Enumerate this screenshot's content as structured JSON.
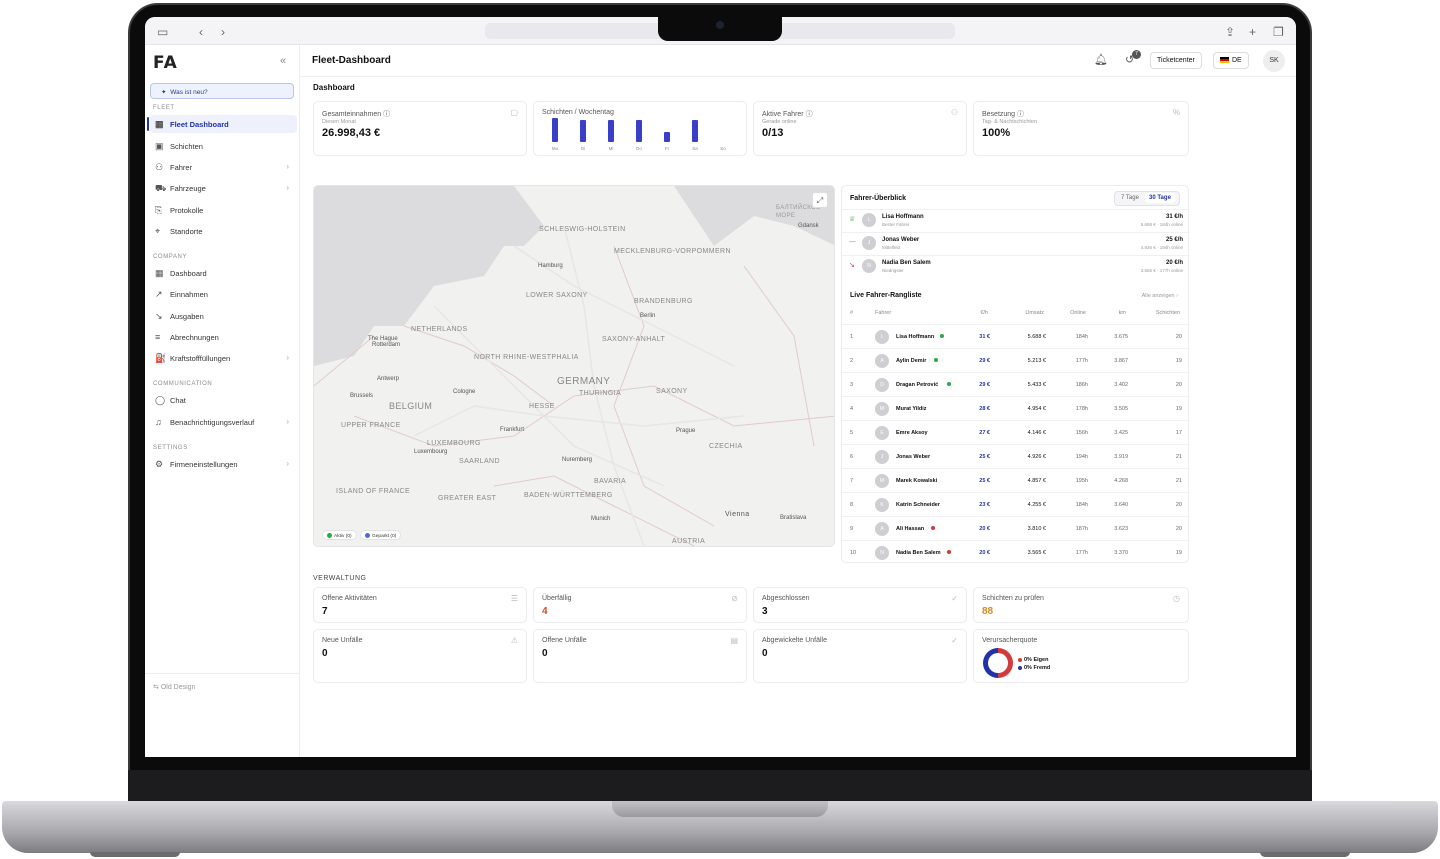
{
  "app": {
    "logo": "FA",
    "title": "Fleet-Dashboard",
    "breadcrumb": "Dashboard"
  },
  "sidebar": {
    "whats_new": "Was ist neu?",
    "sections": [
      {
        "label": "FLEET"
      },
      {
        "label": "COMPANY"
      },
      {
        "label": "COMMUNICATION"
      },
      {
        "label": "SETTINGS"
      }
    ],
    "items": [
      {
        "label": "Fleet Dashboard",
        "icon": "grid-icon"
      },
      {
        "label": "Schichten",
        "icon": "calendar-icon"
      },
      {
        "label": "Fahrer",
        "icon": "users-icon"
      },
      {
        "label": "Fahrzeuge",
        "icon": "car-icon"
      },
      {
        "label": "Protokolle",
        "icon": "log-icon"
      },
      {
        "label": "Standorte",
        "icon": "pin-icon"
      },
      {
        "label": "Dashboard",
        "icon": "grid-icon"
      },
      {
        "label": "Einnahmen",
        "icon": "trend-up-icon"
      },
      {
        "label": "Ausgaben",
        "icon": "trend-down-icon"
      },
      {
        "label": "Abrechnungen",
        "icon": "bars-icon"
      },
      {
        "label": "Kraftstofffüllungen",
        "icon": "fuel-icon"
      },
      {
        "label": "Chat",
        "icon": "chat-icon"
      },
      {
        "label": "Benachrichtigungsverlauf",
        "icon": "bell-icon"
      },
      {
        "label": "Firmeneinstellungen",
        "icon": "gear-icon"
      }
    ],
    "old_design": "Old Design"
  },
  "topbar": {
    "badge": "7",
    "ticketcenter": "Ticketcenter",
    "lang": "DE",
    "user": "SK"
  },
  "kpis": [
    {
      "label": "Gesamteinnahmen",
      "sub": "Diesen Monat",
      "value": "26.998,43 €"
    },
    {
      "label": "Schichten / Wochentag"
    },
    {
      "label": "Aktive Fahrer",
      "sub": "Gerade online",
      "value": "0/13"
    },
    {
      "label": "Besetzung",
      "sub": "Tag- & Nachtschichten",
      "value": "100%"
    }
  ],
  "chart_data": {
    "type": "bar",
    "title": "Schichten / Wochentag",
    "categories": [
      "Mo",
      "Di",
      "Mi",
      "Do",
      "Fr",
      "Sa",
      "So"
    ],
    "values": [
      5,
      4.5,
      4.5,
      4.5,
      2,
      4.5,
      0
    ],
    "ylim": [
      0,
      5
    ],
    "grid": false
  },
  "map": {
    "regions": [
      "Schleswig-Holstein",
      "Mecklenburg-Vorpommern",
      "Lower Saxony",
      "Brandenburg",
      "Netherlands",
      "North Rhine-Westphalia",
      "Saxony-Anhalt",
      "Germany",
      "Belgium",
      "Hesse",
      "Thuringia",
      "Saxony",
      "Upper France",
      "Luxembourg",
      "Saarland",
      "Czechia",
      "Bavaria",
      "Baden-Württemberg",
      "Island of France",
      "Greater East",
      "Austria"
    ],
    "cities": [
      "Hamburg",
      "Berlin",
      "The Hague",
      "Rotterdam",
      "Antwerp",
      "Cologne",
      "Brussels",
      "Frankfurt",
      "Prague",
      "Luxembourg",
      "Nuremberg",
      "Munich",
      "Vienna",
      "Bratislava",
      "Gdansk"
    ],
    "sea": "Балтийское море",
    "legend": [
      {
        "label": "Aktiv (0)",
        "color": "#2ca84a"
      },
      {
        "label": "Geparkt (0)",
        "color": "#5b63d8"
      }
    ]
  },
  "overview": {
    "title": "Fahrer-Überblick",
    "tabs": [
      "7 Tage",
      "30 Tage"
    ],
    "rows": [
      {
        "initial": "L",
        "name": "Lisa Hoffmann",
        "desc": "Bester Fahrer",
        "rate": "31 €/h",
        "sub": "5.688 € · 184h online"
      },
      {
        "initial": "J",
        "name": "Jonas Weber",
        "desc": "Mittelfeld",
        "rate": "25 €/h",
        "sub": "4.926 € · 194h online"
      },
      {
        "initial": "N",
        "name": "Nadia Ben Salem",
        "desc": "Niedrigster",
        "rate": "20 €/h",
        "sub": "3.565 € · 177h online"
      }
    ]
  },
  "leaderboard": {
    "title": "Live Fahrer-Rangliste",
    "all": "Alle anzeigen",
    "columns": [
      "#",
      "Fahrer",
      "€/h",
      "Umsatz",
      "Online",
      "km",
      "Schichten"
    ],
    "rows": [
      {
        "n": "1",
        "i": "L",
        "name": "Lisa Hoffmann",
        "dot": "#2ca84a",
        "rate": "31 €",
        "rev": "5.688 €",
        "on": "184h",
        "km": "3.675",
        "s": "20"
      },
      {
        "n": "2",
        "i": "A",
        "name": "Aylin Demir",
        "dot": "#2ca84a",
        "rate": "29 €",
        "rev": "5.213 €",
        "on": "177h",
        "km": "3.867",
        "s": "19"
      },
      {
        "n": "3",
        "i": "D",
        "name": "Dragan Petrović",
        "dot": "#2ca84a",
        "rate": "29 €",
        "rev": "5.433 €",
        "on": "186h",
        "km": "3.402",
        "s": "20"
      },
      {
        "n": "4",
        "i": "M",
        "name": "Murat Yildiz",
        "dot": "",
        "rate": "28 €",
        "rev": "4.954 €",
        "on": "178h",
        "km": "3.505",
        "s": "19"
      },
      {
        "n": "5",
        "i": "E",
        "name": "Emre Aksoy",
        "dot": "",
        "rate": "27 €",
        "rev": "4.146 €",
        "on": "156h",
        "km": "3.425",
        "s": "17"
      },
      {
        "n": "6",
        "i": "J",
        "name": "Jonas Weber",
        "dot": "",
        "rate": "25 €",
        "rev": "4.926 €",
        "on": "194h",
        "km": "3.919",
        "s": "21"
      },
      {
        "n": "7",
        "i": "M",
        "name": "Marek Kowalski",
        "dot": "",
        "rate": "25 €",
        "rev": "4.857 €",
        "on": "195h",
        "km": "4.268",
        "s": "21"
      },
      {
        "n": "8",
        "i": "K",
        "name": "Katrin Schneider",
        "dot": "",
        "rate": "23 €",
        "rev": "4.255 €",
        "on": "184h",
        "km": "3.640",
        "s": "20"
      },
      {
        "n": "9",
        "i": "A",
        "name": "Ali Hassan",
        "dot": "#d23b3b",
        "rate": "20 €",
        "rev": "3.810 €",
        "on": "187h",
        "km": "3.623",
        "s": "20"
      },
      {
        "n": "10",
        "i": "N",
        "name": "Nadia Ben Salem",
        "dot": "#d23b3b",
        "rate": "20 €",
        "rev": "3.565 €",
        "on": "177h",
        "km": "3.370",
        "s": "19"
      }
    ]
  },
  "verwaltung": {
    "title": "VERWALTUNG",
    "cards": [
      {
        "label": "Offene Aktivitäten",
        "value": "7",
        "color": "#111"
      },
      {
        "label": "Überfällig",
        "value": "4",
        "color": "#d24a2a"
      },
      {
        "label": "Abgeschlossen",
        "value": "3",
        "color": "#111"
      },
      {
        "label": "Schichten zu prüfen",
        "value": "88",
        "color": "#d98a1a"
      },
      {
        "label": "Neue Unfälle",
        "value": "0",
        "color": "#111"
      },
      {
        "label": "Offene Unfälle",
        "value": "0",
        "color": "#111"
      },
      {
        "label": "Abgewickelte Unfälle",
        "value": "0",
        "color": "#111"
      }
    ],
    "quote": {
      "label": "Verursacherquote",
      "eigen": "0% Eigen",
      "fremd": "0% Fremd"
    }
  },
  "colors": {
    "accent": "#2233aa",
    "bar": "#3a3fc8",
    "red": "#d23b3b",
    "green": "#2ca84a"
  }
}
